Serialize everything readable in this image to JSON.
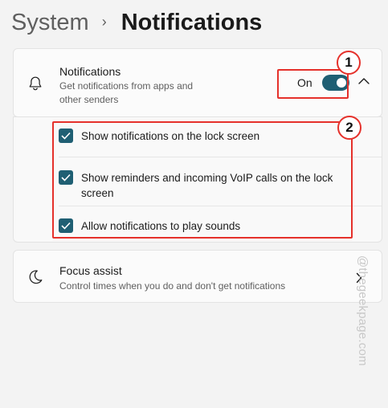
{
  "breadcrumb": {
    "parent": "System",
    "separator": "›",
    "current": "Notifications"
  },
  "notifications": {
    "title": "Notifications",
    "description_line1": "Get notifications from apps and",
    "description_line2": "other senders",
    "toggle_label": "On",
    "toggle_on": true
  },
  "options": [
    {
      "label": "Show notifications on the lock screen",
      "checked": true
    },
    {
      "label": "Show reminders and incoming VoIP calls on the lock screen",
      "checked": true
    },
    {
      "label": "Allow notifications to play sounds",
      "checked": true
    }
  ],
  "focus_assist": {
    "title": "Focus assist",
    "description": "Control times when you do and don't get notifications"
  },
  "annotations": {
    "badge1": "1",
    "badge2": "2"
  },
  "watermark": "@thegeekpage.com",
  "colors": {
    "accent": "#1f5f73",
    "highlight": "#e5312b",
    "background": "#f3f3f3"
  }
}
